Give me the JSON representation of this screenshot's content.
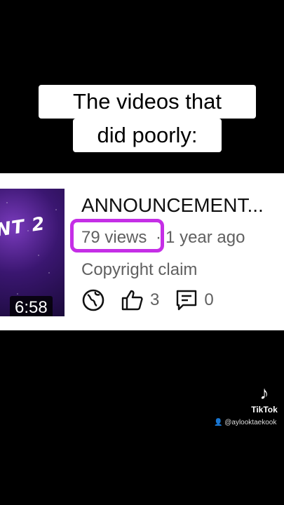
{
  "caption": {
    "line1": "The videos that",
    "line2": "did poorly:"
  },
  "video": {
    "thumbnail_text": "NT 2",
    "duration": "6:58",
    "title": "ANNOUNCEMENT...",
    "views": "79 views",
    "separator": "·",
    "age": "1 year ago",
    "status": "Copyright claim",
    "likes": "3",
    "comments": "0",
    "highlight_color": "#c52ee6"
  },
  "watermark": {
    "brand": "TikTok",
    "handle": "@aylooktaekook"
  }
}
